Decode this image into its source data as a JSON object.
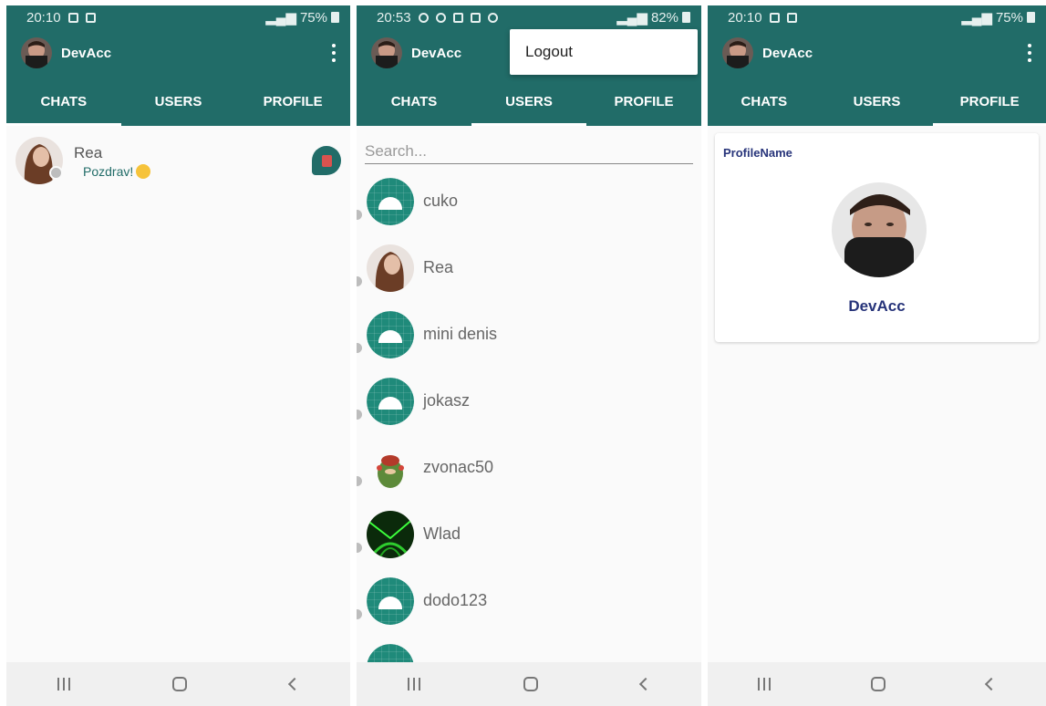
{
  "screens": [
    {
      "status": {
        "time": "20:10",
        "battery": "75%"
      },
      "app_title": "DevAcc",
      "tabs": [
        "CHATS",
        "USERS",
        "PROFILE"
      ],
      "active_tab": 0,
      "chats": [
        {
          "name": "Rea",
          "last_message": "Pozdrav!"
        }
      ]
    },
    {
      "status": {
        "time": "20:53",
        "battery": "82%"
      },
      "app_title": "DevAcc",
      "tabs": [
        "CHATS",
        "USERS",
        "PROFILE"
      ],
      "active_tab": 1,
      "menu": {
        "logout": "Logout"
      },
      "search_placeholder": "Search...",
      "users": [
        {
          "name": "cuko",
          "avatar": "android-icon"
        },
        {
          "name": "Rea",
          "avatar": "photo-woman"
        },
        {
          "name": "mini denis",
          "avatar": "android-icon"
        },
        {
          "name": "jokasz",
          "avatar": "android-icon"
        },
        {
          "name": "zvonac50",
          "avatar": "cartoon-character"
        },
        {
          "name": "Wlad",
          "avatar": "green-lights-photo"
        },
        {
          "name": "dodo123",
          "avatar": "android-icon"
        },
        {
          "name": "",
          "avatar": "android-icon"
        }
      ]
    },
    {
      "status": {
        "time": "20:10",
        "battery": "75%"
      },
      "app_title": "DevAcc",
      "tabs": [
        "CHATS",
        "USERS",
        "PROFILE"
      ],
      "active_tab": 2,
      "profile": {
        "label": "ProfileName",
        "name": "DevAcc"
      }
    }
  ],
  "colors": {
    "primary": "#216c68",
    "accent_text": "#27347a",
    "status_gray": "#bdbdbd"
  }
}
